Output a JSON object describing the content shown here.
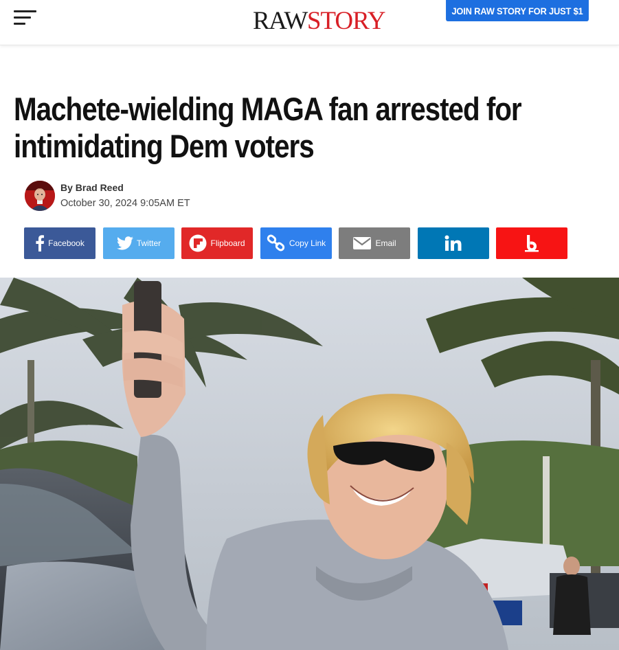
{
  "header": {
    "logo_left": "RAW",
    "logo_right": "STORY",
    "join_label": "JOIN RAW STORY FOR JUST $1"
  },
  "article": {
    "headline": "Machete-wielding MAGA fan arrested for intimidating Dem voters",
    "author": "By Brad Reed",
    "date": "October 30, 2024 9:05AM ET"
  },
  "share": {
    "facebook": "Facebook",
    "twitter": "Twitter",
    "flipboard": "Flipboard",
    "copy_link": "Copy Link",
    "email": "Email"
  },
  "colors": {
    "brand_red": "#d81f26",
    "join_blue": "#1d6fe0",
    "facebook": "#3b5998",
    "twitter": "#55acee",
    "flipboard": "#e12828",
    "copy_link": "#2f80ed",
    "email": "#7d7d7d",
    "linkedin": "#0077b5",
    "beehiiv": "#f71414"
  },
  "icons": [
    "menu-icon",
    "facebook-icon",
    "twitter-icon",
    "flipboard-icon",
    "link-icon",
    "email-icon",
    "linkedin-icon",
    "beehiiv-icon"
  ]
}
